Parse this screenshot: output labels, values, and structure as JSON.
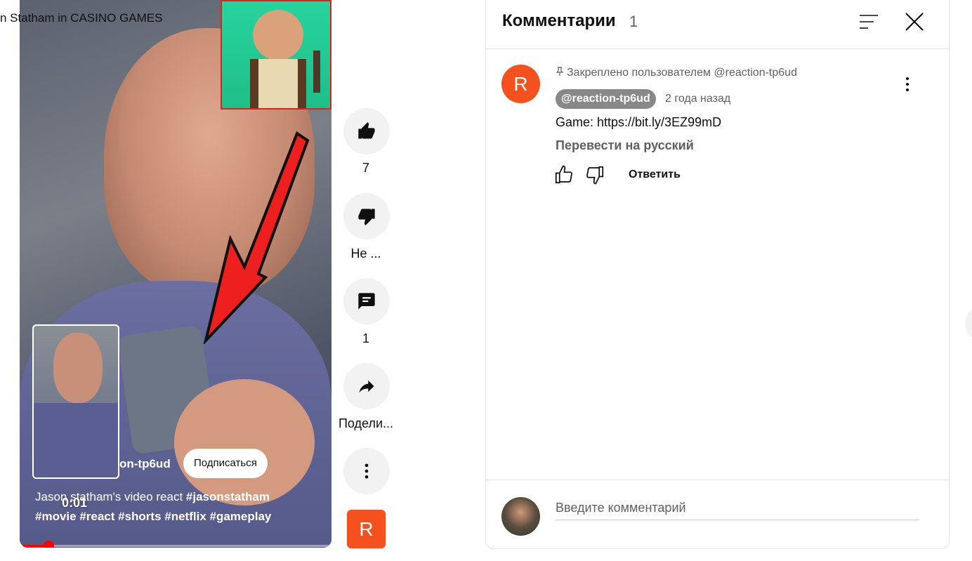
{
  "video": {
    "title": "n Statham in CASINO GAMES",
    "time": "0:01",
    "progress_percent": 8,
    "channel": "on-tp6ud",
    "subscribe_label": "Подписаться",
    "desc_plain": "Jason statham's video react ",
    "desc_tags_line1": "#jasonstatham",
    "desc_tags_line2": "#movie #react #shorts #netflix #gameplay"
  },
  "actions": {
    "like_count": "7",
    "dislike_label": "Не ...",
    "comments_count": "1",
    "share_label": "Подели...",
    "channel_initial": "R"
  },
  "panel": {
    "title": "Комментарии",
    "count": "1",
    "comment": {
      "avatar_initial": "R",
      "pinned_text": "Закреплено пользователем @reaction-tp6ud",
      "author": "@reaction-tp6ud",
      "ago": "2 года назад",
      "text": "Game: https://bit.ly/3EZ99mD",
      "translate": "Перевести на русский",
      "reply": "Ответить"
    },
    "input_placeholder": "Введите комментарий"
  },
  "colors": {
    "accent": "#ff0000",
    "avatar": "#f4511e"
  }
}
